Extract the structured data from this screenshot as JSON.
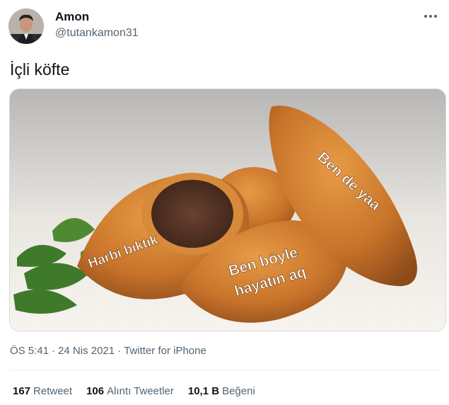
{
  "author": {
    "name": "Amon",
    "handle": "@tutankamon31"
  },
  "tweet": {
    "text": "İçli köfte"
  },
  "image": {
    "labels": {
      "left": "Harbi bıktık",
      "middle_line1": "Ben böyle",
      "middle_line2": "hayatın aq",
      "right": "Ben de yaa"
    }
  },
  "meta": {
    "time": "ÖS 5:41",
    "date": "24 Nis 2021",
    "source": "Twitter for iPhone"
  },
  "stats": [
    {
      "count": "167",
      "label": "Retweet"
    },
    {
      "count": "106",
      "label": "Alıntı Tweetler"
    },
    {
      "count": "10,1 B",
      "label": "Beğeni"
    }
  ],
  "icons": {
    "more": "more-icon"
  }
}
